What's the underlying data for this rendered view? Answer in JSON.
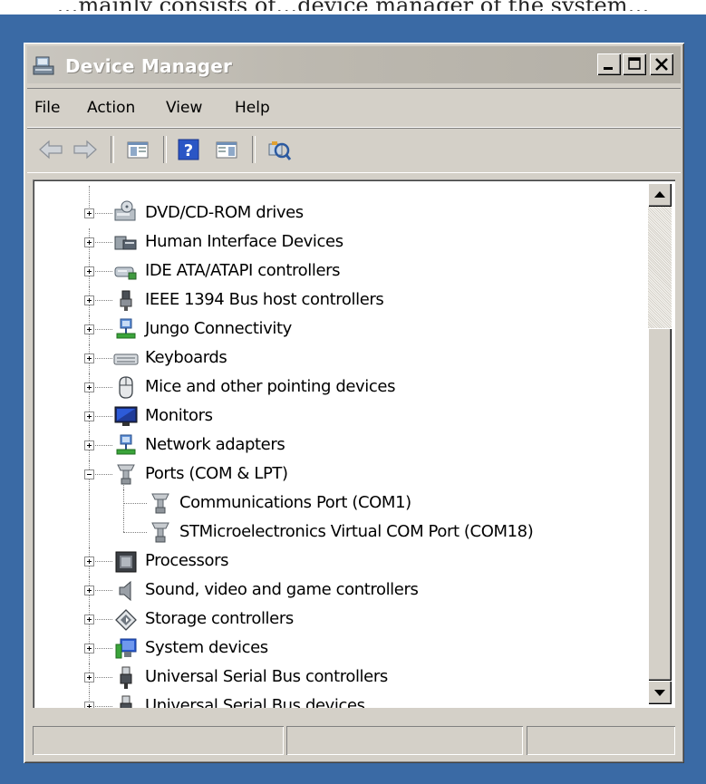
{
  "caption_fragment": "…mainly consists of…device manager of the system…",
  "window": {
    "title": "Device Manager",
    "buttons": {
      "minimize": "minimize",
      "maximize": "maximize",
      "close": "close"
    }
  },
  "menu": [
    "File",
    "Action",
    "View",
    "Help"
  ],
  "toolbar": {
    "buttons": [
      "back-icon",
      "forward-icon",
      "properties-pane-icon",
      "help-icon",
      "action-pane-icon",
      "scan-hardware-icon"
    ]
  },
  "tree": {
    "items": [
      {
        "label": "DVD/CD-ROM drives",
        "icon": "dvd-drive-icon",
        "expanded": false,
        "level": 0
      },
      {
        "label": "Human Interface Devices",
        "icon": "hid-icon",
        "expanded": false,
        "level": 0
      },
      {
        "label": "IDE ATA/ATAPI controllers",
        "icon": "ide-controller-icon",
        "expanded": false,
        "level": 0
      },
      {
        "label": "IEEE 1394 Bus host controllers",
        "icon": "ieee1394-icon",
        "expanded": false,
        "level": 0
      },
      {
        "label": "Jungo Connectivity",
        "icon": "network-device-icon",
        "expanded": false,
        "level": 0
      },
      {
        "label": "Keyboards",
        "icon": "keyboard-icon",
        "expanded": false,
        "level": 0
      },
      {
        "label": "Mice and other pointing devices",
        "icon": "mouse-icon",
        "expanded": false,
        "level": 0
      },
      {
        "label": "Monitors",
        "icon": "monitor-icon",
        "expanded": false,
        "level": 0
      },
      {
        "label": "Network adapters",
        "icon": "network-adapter-icon",
        "expanded": false,
        "level": 0
      },
      {
        "label": "Ports (COM & LPT)",
        "icon": "port-icon",
        "expanded": true,
        "level": 0
      },
      {
        "label": "Communications Port (COM1)",
        "icon": "port-icon",
        "expanded": null,
        "level": 1
      },
      {
        "label": "STMicroelectronics Virtual COM Port (COM18)",
        "icon": "port-icon",
        "expanded": null,
        "level": 1
      },
      {
        "label": "Processors",
        "icon": "processor-icon",
        "expanded": false,
        "level": 0
      },
      {
        "label": "Sound, video and game controllers",
        "icon": "speaker-icon",
        "expanded": false,
        "level": 0
      },
      {
        "label": "Storage controllers",
        "icon": "storage-controller-icon",
        "expanded": false,
        "level": 0
      },
      {
        "label": "System devices",
        "icon": "system-device-icon",
        "expanded": false,
        "level": 0
      },
      {
        "label": "Universal Serial Bus controllers",
        "icon": "usb-icon",
        "expanded": false,
        "level": 0
      },
      {
        "label": "Universal Serial Bus devices",
        "icon": "usb-icon",
        "expanded": false,
        "level": 0
      }
    ]
  },
  "statusbar": {
    "panels": [
      "",
      "",
      ""
    ]
  }
}
